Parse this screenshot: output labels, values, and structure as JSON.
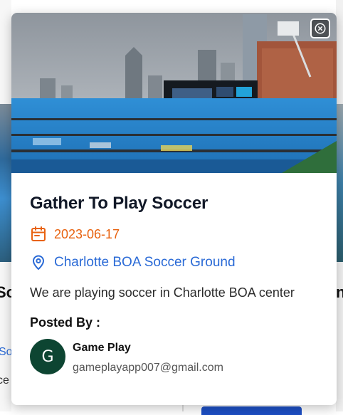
{
  "background": {
    "left_title": "So",
    "left_link": "So",
    "left_text": "ce",
    "right_title": "n"
  },
  "event": {
    "title": "Gather To Play Soccer",
    "date": "2023-06-17",
    "location": "Charlotte BOA Soccer Ground",
    "description": "We are playing soccer in Charlotte BOA center",
    "hero_image": "stadium-photo"
  },
  "posted_by": {
    "label": "Posted By :",
    "avatar_initial": "G",
    "name": "Game Play",
    "email": "gameplayapp007@gmail.com"
  },
  "colors": {
    "date": "#e8620f",
    "location": "#2a6ad6",
    "avatar": "#0d4532"
  },
  "icons": {
    "close": "close-icon",
    "date": "calendar-icon",
    "location": "map-pin-icon"
  }
}
